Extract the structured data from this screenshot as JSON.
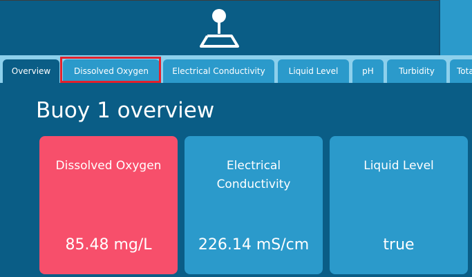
{
  "header": {
    "logo_icon": "joystick-icon"
  },
  "tabs": [
    {
      "label": "Overview",
      "active": true
    },
    {
      "label": "Dissolved Oxygen",
      "active": false,
      "highlighted": true
    },
    {
      "label": "Electrical Conductivity",
      "active": false
    },
    {
      "label": "Liquid Level",
      "active": false
    },
    {
      "label": "pH",
      "active": false
    },
    {
      "label": "Turbidity",
      "active": false
    },
    {
      "label": "Tota",
      "active": false
    }
  ],
  "page": {
    "title": "Buoy 1 overview"
  },
  "cards": [
    {
      "label": "Dissolved Oxygen",
      "value": "85.48 mg/L",
      "color": "#f74f6b"
    },
    {
      "label": "Electrical Conductivity",
      "value": "226.14 mS/cm",
      "color": "#2b9acb"
    },
    {
      "label": "Liquid Level",
      "value": "true",
      "color": "#2b9acb"
    }
  ],
  "colors": {
    "primary": "#0a5d86",
    "accent": "#2b9acb",
    "tab_strip": "#8dd0ec",
    "alert": "#f74f6b",
    "highlight": "#e4202b"
  }
}
